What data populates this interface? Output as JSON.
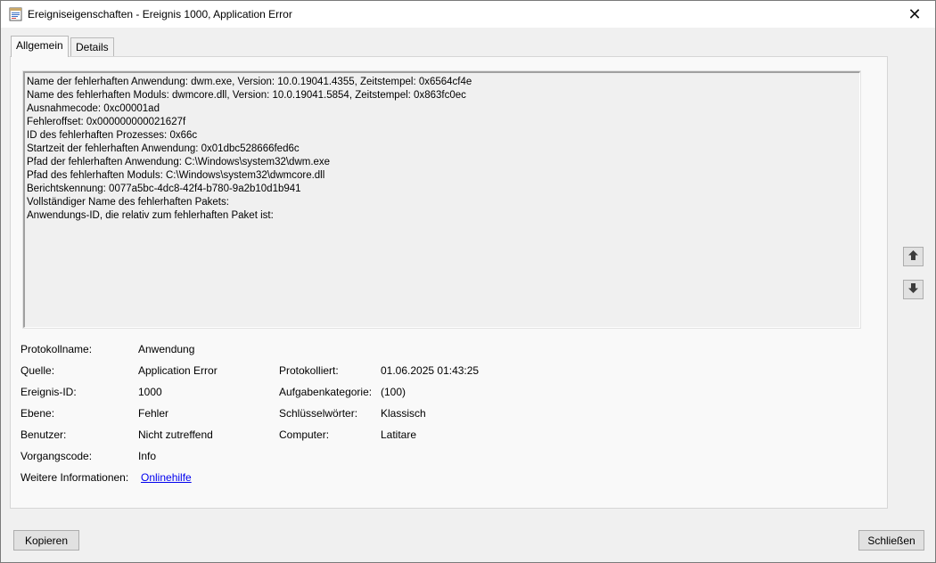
{
  "window": {
    "title": "Ereigniseigenschaften - Ereignis 1000, Application Error",
    "close_glyph": "✕"
  },
  "tabs": [
    {
      "label": "Allgemein",
      "active": true
    },
    {
      "label": "Details",
      "active": false
    }
  ],
  "description": {
    "lines": [
      "Name der fehlerhaften Anwendung: dwm.exe, Version: 10.0.19041.4355, Zeitstempel: 0x6564cf4e",
      "Name des fehlerhaften Moduls: dwmcore.dll, Version: 10.0.19041.5854, Zeitstempel: 0x863fc0ec",
      "Ausnahmecode: 0xc00001ad",
      "Fehleroffset: 0x000000000021627f",
      "ID des fehlerhaften Prozesses: 0x66c",
      "Startzeit der fehlerhaften Anwendung: 0x01dbc528666fed6c",
      "Pfad der fehlerhaften Anwendung: C:\\Windows\\system32\\dwm.exe",
      "Pfad des fehlerhaften Moduls: C:\\Windows\\system32\\dwmcore.dll",
      "Berichtskennung: 0077a5bc-4dc8-42f4-b780-9a2b10d1b941",
      "Vollständiger Name des fehlerhaften Pakets:",
      "Anwendungs-ID, die relativ zum fehlerhaften Paket ist:"
    ]
  },
  "properties": {
    "protokollname": {
      "label": "Protokollname:",
      "value": "Anwendung"
    },
    "quelle": {
      "label": "Quelle:",
      "value": "Application Error"
    },
    "protokolliert": {
      "label": "Protokolliert:",
      "value": "01.06.2025 01:43:25"
    },
    "ereignis_id": {
      "label": "Ereignis-ID:",
      "value": "1000"
    },
    "aufgabenkategorie": {
      "label": "Aufgabenkategorie:",
      "value": "(100)"
    },
    "ebene": {
      "label": "Ebene:",
      "value": "Fehler"
    },
    "schluesselwoerter": {
      "label": "Schlüsselwörter:",
      "value": "Klassisch"
    },
    "benutzer": {
      "label": "Benutzer:",
      "value": "Nicht zutreffend"
    },
    "computer": {
      "label": "Computer:",
      "value": "Latitare"
    },
    "vorgangscode": {
      "label": "Vorgangscode:",
      "value": "Info"
    },
    "weitere": {
      "label": "Weitere Informationen:",
      "value": "Onlinehilfe"
    }
  },
  "buttons": {
    "copy": "Kopieren",
    "close": "Schließen"
  },
  "icons": {
    "app": "event-properties-icon",
    "up": "arrow-up-icon",
    "down": "arrow-down-icon"
  },
  "colors": {
    "link": "#0000ee",
    "background": "#f0f0f0"
  }
}
